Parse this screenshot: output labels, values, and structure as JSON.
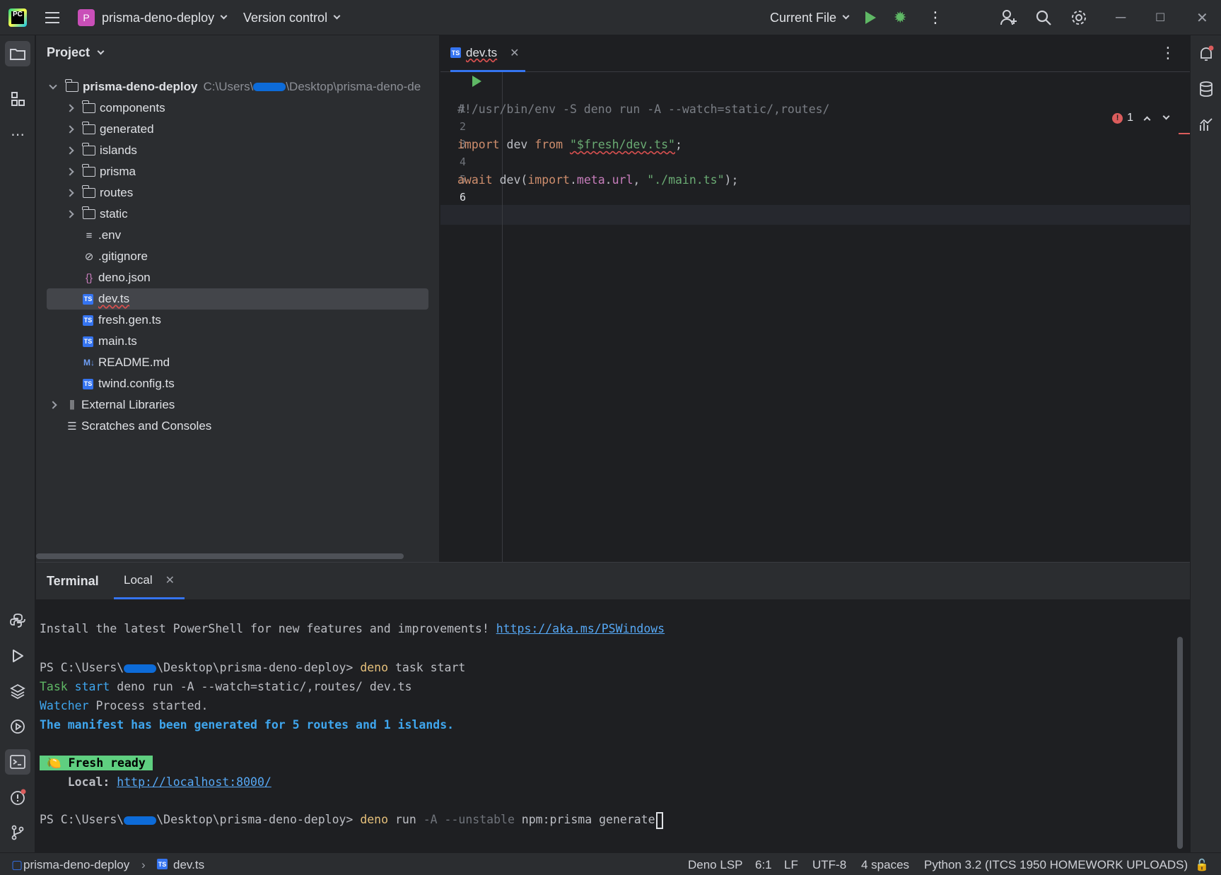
{
  "titlebar": {
    "project_badge": "P",
    "project_name": "prisma-deno-deploy",
    "vcs": "Version control",
    "run_config": "Current File",
    "window": {
      "minimize": "─",
      "maximize": "☐",
      "close": "✕"
    }
  },
  "project_panel": {
    "title": "Project",
    "root": {
      "name": "prisma-deno-deploy",
      "path_prefix": "C:\\Users\\",
      "path_suffix": "\\Desktop\\prisma-deno-de"
    },
    "items": [
      {
        "label": "components",
        "kind": "folder"
      },
      {
        "label": "generated",
        "kind": "folder"
      },
      {
        "label": "islands",
        "kind": "folder"
      },
      {
        "label": "prisma",
        "kind": "folder"
      },
      {
        "label": "routes",
        "kind": "folder"
      },
      {
        "label": "static",
        "kind": "folder"
      },
      {
        "label": ".env",
        "kind": "env"
      },
      {
        "label": ".gitignore",
        "kind": "ignore"
      },
      {
        "label": "deno.json",
        "kind": "json"
      },
      {
        "label": "dev.ts",
        "kind": "ts",
        "selected": true
      },
      {
        "label": "fresh.gen.ts",
        "kind": "ts"
      },
      {
        "label": "main.ts",
        "kind": "ts"
      },
      {
        "label": "README.md",
        "kind": "md"
      },
      {
        "label": "twind.config.ts",
        "kind": "ts"
      }
    ],
    "external_libraries": "External Libraries",
    "scratches": "Scratches and Consoles"
  },
  "editor": {
    "tab": "dev.ts",
    "ts_badge": "TS",
    "error_count": "1",
    "lines": [
      {
        "n": "1",
        "text": "#!/usr/bin/env -S deno run -A --watch=static/,routes/"
      },
      {
        "n": "2",
        "text": ""
      },
      {
        "n": "3",
        "kw1": "import",
        "mid": " dev ",
        "kw2": "from",
        "sp": " ",
        "str": "\"$fresh/dev.ts\"",
        "end": ";"
      },
      {
        "n": "4",
        "text": ""
      },
      {
        "n": "5",
        "kw1": "await",
        "a": " dev(",
        "b": "import",
        "c": ".",
        "d": "meta",
        "e": ".",
        "f": "url",
        "g": ", ",
        "str": "\"./main.ts\"",
        "end": ");"
      },
      {
        "n": "6",
        "text": ""
      }
    ]
  },
  "terminal": {
    "title": "Terminal",
    "tab": "Local",
    "install_msg": "Install the latest PowerShell for new features and improvements! ",
    "install_link": "https://aka.ms/PSWindows",
    "prompt_prefix": "PS C:\\Users\\",
    "prompt_suffix": "\\Desktop\\prisma-deno-deploy> ",
    "cmd1_a": "deno",
    "cmd1_b": " task start",
    "task_a": "Task",
    "task_b": " start",
    "task_c": " deno run -A --watch=static/,routes/ dev.ts",
    "watcher_a": "Watcher",
    "watcher_b": " Process started.",
    "manifest": "The manifest has been generated for 5 routes and 1 islands.",
    "fresh_icon": "🍋",
    "fresh": "Fresh ready",
    "local_label": "    Local: ",
    "local_link": "http://localhost:8000/",
    "cmd2_a": "deno",
    "cmd2_b": " run ",
    "cmd2_c": "-A --unstable",
    "cmd2_d": " npm:prisma generate"
  },
  "statusbar": {
    "project": "prisma-deno-deploy",
    "file": "dev.ts",
    "lsp": "Deno LSP",
    "position": "6:1",
    "line_sep": "LF",
    "encoding": "UTF-8",
    "indent": "4 spaces",
    "interpreter": "Python 3.2 (ITCS 1950 HOMEWORK UPLOADS)"
  }
}
